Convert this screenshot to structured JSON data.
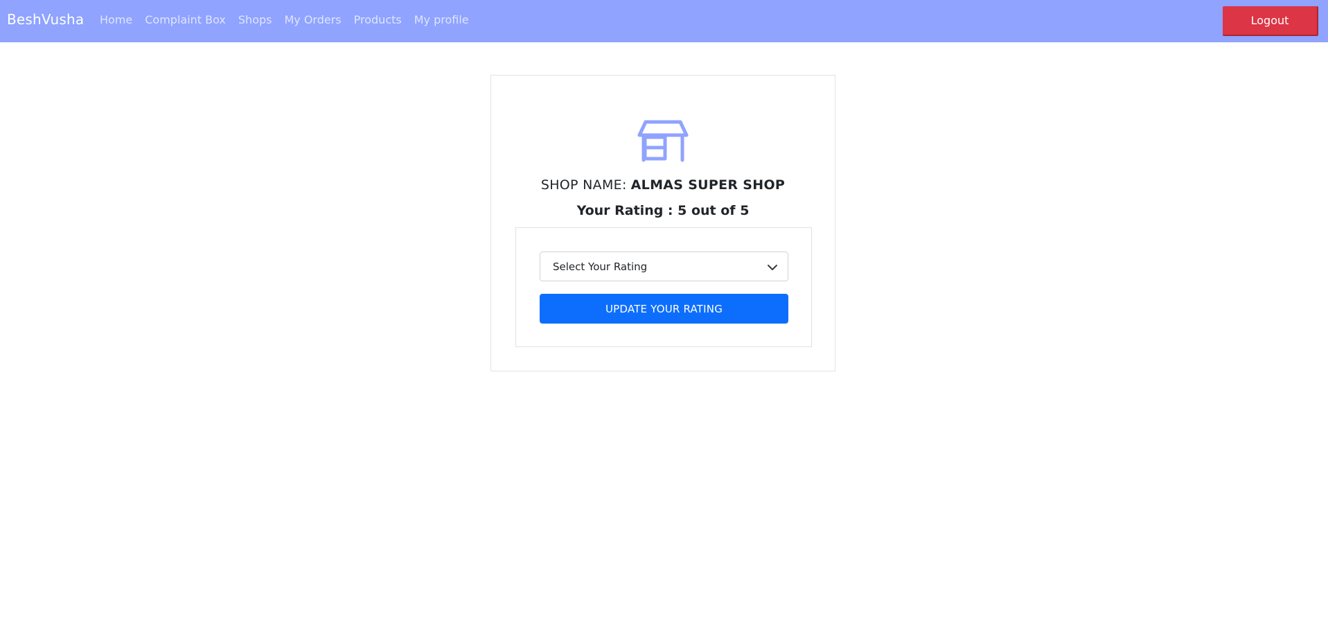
{
  "navbar": {
    "brand": "BeshVusha",
    "links": [
      {
        "label": "Home"
      },
      {
        "label": "Complaint Box"
      },
      {
        "label": "Shops"
      },
      {
        "label": "My Orders"
      },
      {
        "label": "Products"
      },
      {
        "label": "My profile"
      }
    ],
    "logout_label": "Logout"
  },
  "card": {
    "icon": "shop-icon",
    "shop_name_label": "SHOP NAME:",
    "shop_name_value": "ALMAS SUPER SHOP",
    "rating_text": "Your Rating : 5 out of 5",
    "select": {
      "selected": "Select Your Rating"
    },
    "update_label": "UPDATE YOUR RATING"
  },
  "colors": {
    "navbar_bg": "#8fa3ff",
    "logout_bg": "#dc3545",
    "primary": "#0d6efd",
    "icon_color": "#8fa3ff"
  }
}
